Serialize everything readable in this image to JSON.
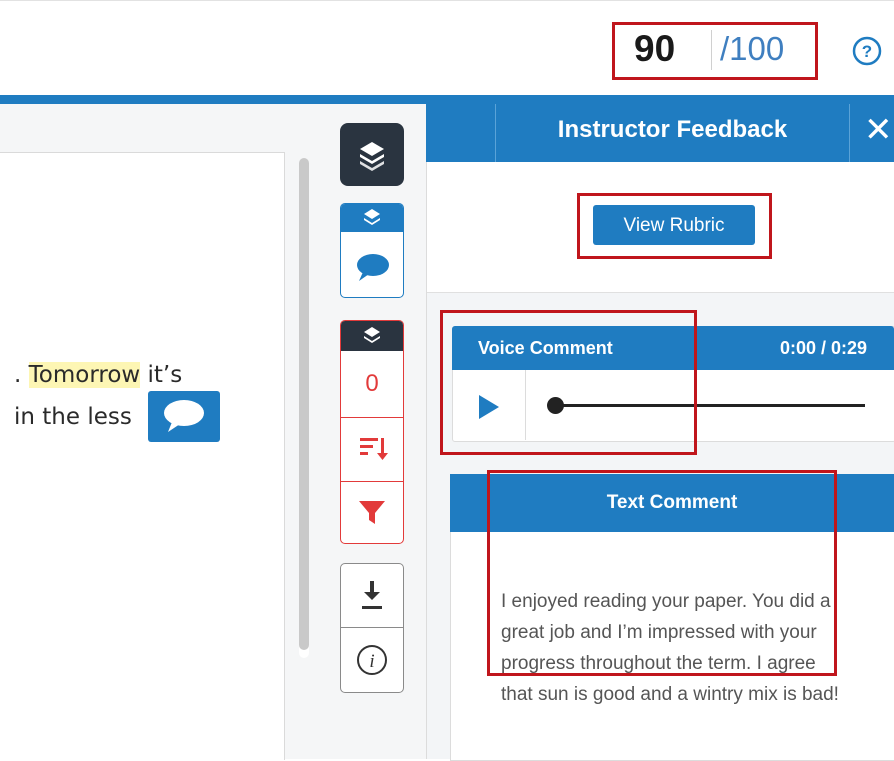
{
  "grade": {
    "score": "90",
    "total": "/100"
  },
  "help": {
    "icon": "help-circle-icon",
    "glyph": "?"
  },
  "document": {
    "line1_prefix": ". ",
    "line1_highlight": "Tomorrow",
    "line1_suffix": " it’s",
    "line2": "in the less",
    "highlight_color": "#fdf6b4"
  },
  "toolbar": {
    "layers_icon": "layers-icon",
    "comment_icon": "comment-icon",
    "count": "0",
    "sort_icon": "sort-icon",
    "filter_icon": "filter-icon",
    "download_icon": "download-icon",
    "info_icon": "info-icon"
  },
  "panel": {
    "title": "Instructor Feedback",
    "close": "✕",
    "rubric_label": "View Rubric",
    "voice": {
      "title": "Voice Comment",
      "time": "0:00 / 0:29",
      "progress": 0
    },
    "text": {
      "title": "Text Comment",
      "body": "I enjoyed reading your paper. You did a great job and I’m impressed with your progress throughout the term. I agree that sun is good and a wintry mix is bad!"
    }
  },
  "colors": {
    "accent": "#1f7cc1",
    "annotation": "#c0161c",
    "alert": "#e23a3a",
    "dark": "#2a3440"
  }
}
